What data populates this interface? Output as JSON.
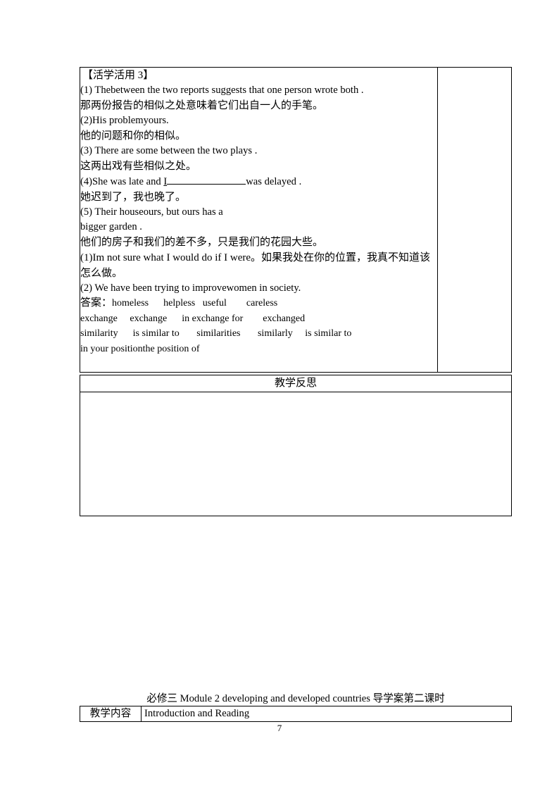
{
  "document": {
    "page_number": "7"
  },
  "exercise": {
    "heading": "【活学活用 3】",
    "items": [
      {
        "en": "(1) Thebetween the two reports suggests that one person wrote both .",
        "cn": "那两份报告的相似之处意味着它们出自一人的手笔。"
      },
      {
        "en": "(2)His problemyours.",
        "cn": "他的问题和你的相似。"
      },
      {
        "en": "(3) There are some between the two plays .",
        "cn": "这两出戏有些相似之处。"
      },
      {
        "en_pre": "(4)She was late and ",
        "en_underlined": "I",
        "en_post": "was delayed .",
        "cn": "她迟到了，我也晚了。"
      },
      {
        "en": "(5) Their houseours, but ours has a",
        "en2": "bigger garden .",
        "cn": "他们的房子和我们的差不多，只是我们的花园大些。"
      }
    ],
    "extra_items": [
      {
        "text": "(1)Im not sure what I would do if I were。如果我处在你的位置，我真不知道该怎么做。"
      },
      {
        "text": "(2) We have been trying to improvewomen in society."
      }
    ],
    "answer_label": "答案：",
    "answer_lines": [
      "homeless      helpless   useful        careless",
      "exchange     exchange      in exchange for        exchanged",
      "similarity      is similar to       similarities       similarly     is similar to",
      "in your positionthe position of"
    ]
  },
  "reflection": {
    "title": "教学反思",
    "content": ""
  },
  "footer": {
    "module_title": "必修三  Module 2 developing and developed countries 导学案第二课时",
    "content_label": "教学内容",
    "content_value": "Introduction and Reading"
  }
}
